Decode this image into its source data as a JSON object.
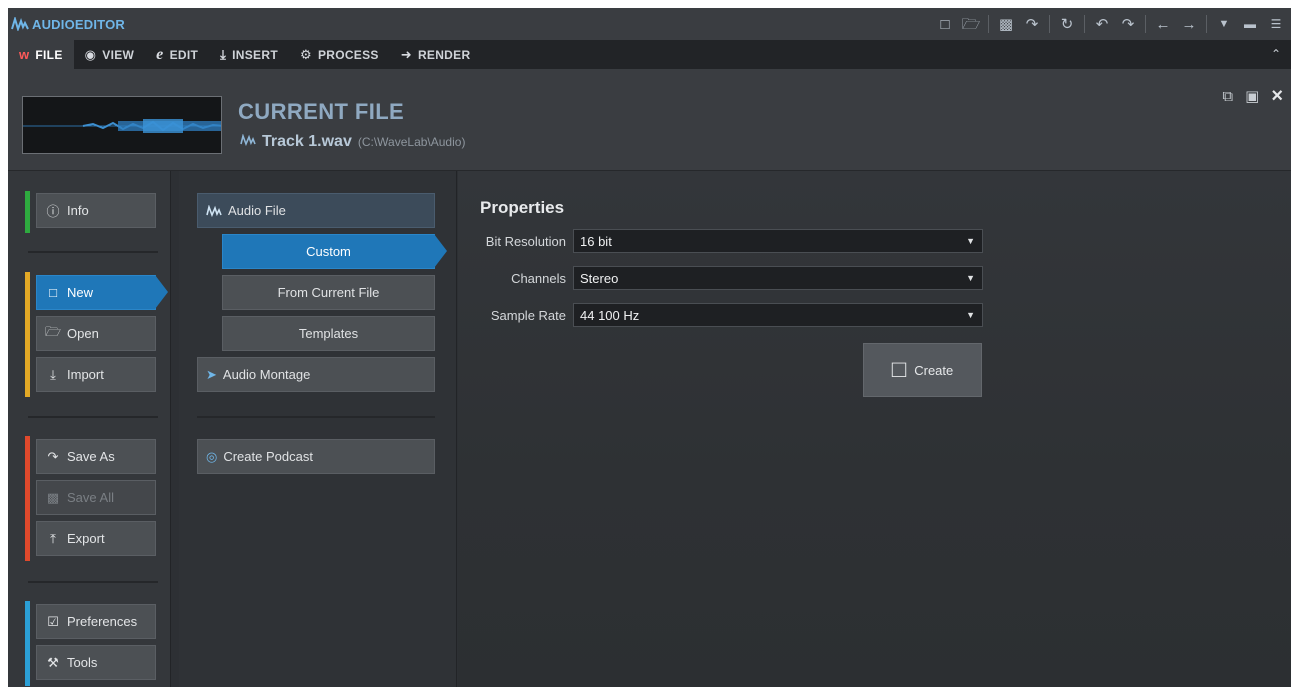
{
  "app": {
    "title": "AUDIOEDITOR",
    "toolbar_icons": [
      "new-file-icon",
      "open-folder-icon",
      "save-icon",
      "save-as-icon",
      "history-icon",
      "undo-icon",
      "redo-icon",
      "back-icon",
      "forward-icon",
      "menu-icon",
      "window-icon",
      "panel-icon"
    ]
  },
  "tabs": [
    {
      "label": "FILE",
      "icon": "file-icon",
      "active": true
    },
    {
      "label": "VIEW",
      "icon": "eye-icon",
      "active": false
    },
    {
      "label": "EDIT",
      "icon": "edit-icon",
      "active": false
    },
    {
      "label": "INSERT",
      "icon": "insert-icon",
      "active": false
    },
    {
      "label": "PROCESS",
      "icon": "process-icon",
      "active": false
    },
    {
      "label": "RENDER",
      "icon": "render-icon",
      "active": false
    }
  ],
  "header": {
    "title": "CURRENT FILE",
    "file_name": "Track 1.wav",
    "file_path": "(C:\\WaveLab\\Audio)"
  },
  "left_nav": {
    "info": "Info",
    "new": "New",
    "open": "Open",
    "import": "Import",
    "save_as": "Save As",
    "save_all": "Save All",
    "export": "Export",
    "preferences": "Preferences",
    "tools": "Tools"
  },
  "middle_nav": {
    "audio_file": "Audio File",
    "custom": "Custom",
    "from_current": "From Current File",
    "templates": "Templates",
    "audio_montage": "Audio Montage",
    "create_podcast": "Create Podcast"
  },
  "properties": {
    "title": "Properties",
    "bit_resolution_label": "Bit Resolution",
    "bit_resolution_value": "16 bit",
    "channels_label": "Channels",
    "channels_value": "Stereo",
    "sample_rate_label": "Sample Rate",
    "sample_rate_value": "44 100 Hz",
    "create_label": "Create"
  },
  "colors": {
    "accent": "#1f77b8",
    "info_group": "#2eaa3f",
    "file_group": "#e3a926",
    "save_group": "#e0492c",
    "settings_group": "#2b9fd6"
  }
}
